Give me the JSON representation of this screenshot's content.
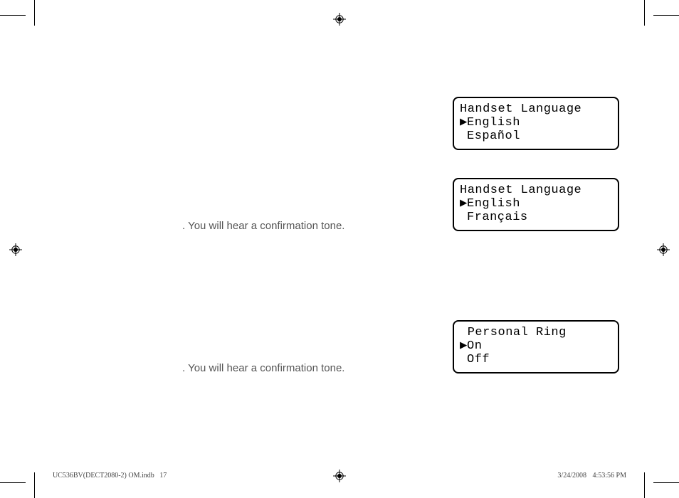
{
  "body": {
    "text1": ". You will hear a confirmation tone.",
    "text2": ". You will hear a confirmation tone."
  },
  "lcd1": {
    "title": "Handset Language",
    "opt1": "English",
    "opt2": "Español"
  },
  "lcd2": {
    "title": "Handset Language",
    "opt1": "English",
    "opt2": "Français"
  },
  "lcd3": {
    "title": " Personal Ring",
    "opt1": "On",
    "opt2": "Off"
  },
  "pointer": "▶",
  "footer": {
    "left_file": "UC536BV(DECT2080-2) OM.indb",
    "left_page": "17",
    "date": "3/24/2008",
    "time": "4:53:56 PM"
  }
}
